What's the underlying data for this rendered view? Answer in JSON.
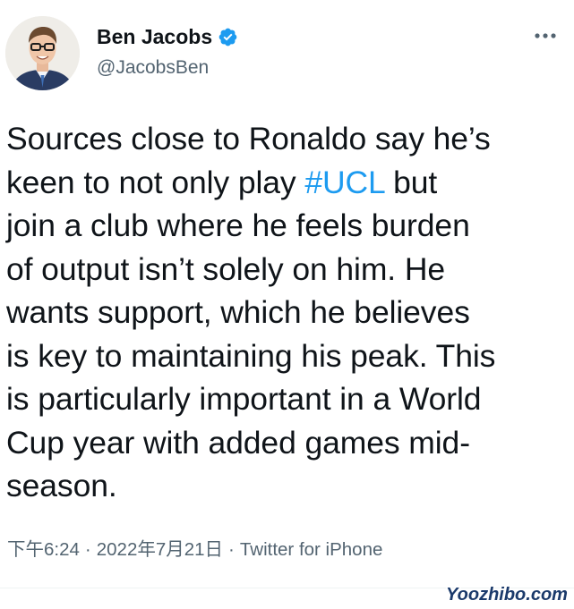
{
  "author": {
    "name": "Ben Jacobs",
    "handle": "@JacobsBen",
    "verified": true,
    "avatar_icon": "person-portrait-avatar"
  },
  "tweet": {
    "lines": [
      [
        "Sources close to Ronaldo say he’s"
      ],
      [
        "keen to not only play ",
        "#UCL",
        " but"
      ],
      [
        "join a club where he feels burden"
      ],
      [
        "of output isn’t solely on him. He"
      ],
      [
        "wants support, which he believes"
      ],
      [
        "is key to maintaining his peak. This"
      ],
      [
        "is particularly important in a World"
      ],
      [
        "Cup year with added games mid-"
      ],
      [
        "season."
      ]
    ],
    "hashtag": "#UCL"
  },
  "meta": {
    "time": "下午6:24",
    "date": "2022年7月21日",
    "separator": "·",
    "source": "Twitter for iPhone"
  },
  "watermark": {
    "text": "Yoozhibo.com"
  },
  "colors": {
    "text": "#0f1419",
    "secondary": "#536471",
    "accent": "#1d9bf0",
    "watermark_fill": "#1b3a6b"
  },
  "icons": {
    "verified": "verified-badge-icon",
    "more": "more-horizontal-icon"
  }
}
